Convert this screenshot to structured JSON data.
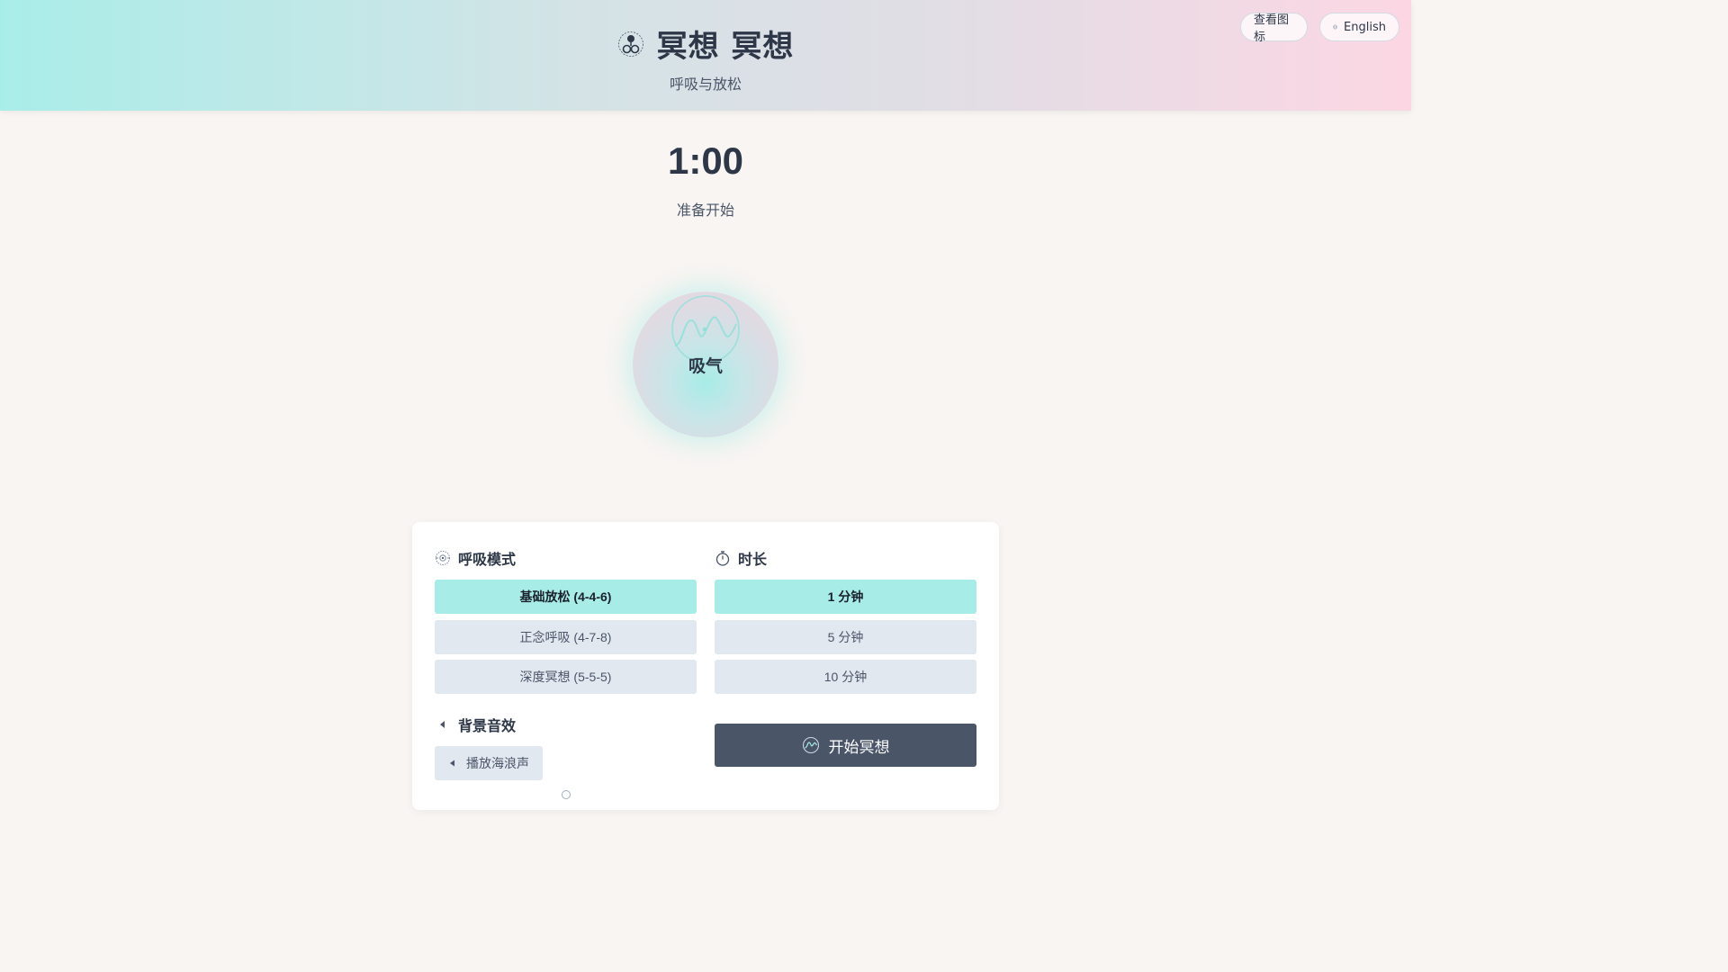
{
  "header": {
    "title": "冥想 冥想",
    "subtitle": "呼吸与放松",
    "icons_button_label": "查看图标",
    "language_button_label": "English"
  },
  "timer": {
    "display": "1:00",
    "status": "准备开始"
  },
  "breath": {
    "phase": "吸气"
  },
  "patterns": {
    "title": "呼吸模式",
    "options": [
      {
        "label": "基础放松 (4-4-6)",
        "active": true
      },
      {
        "label": "正念呼吸 (4-7-8)",
        "active": false
      },
      {
        "label": "深度冥想 (5-5-5)",
        "active": false
      }
    ]
  },
  "duration": {
    "title": "时长",
    "options": [
      {
        "label": "1 分钟",
        "active": true
      },
      {
        "label": "5 分钟",
        "active": false
      },
      {
        "label": "10 分钟",
        "active": false
      }
    ]
  },
  "sound": {
    "title": "背景音效",
    "button_label": "播放海浪声"
  },
  "start": {
    "label": "开始冥想"
  },
  "icons": {
    "logo": "meditation-logo-icon",
    "language": "globe-icon",
    "breath": "breath-wave-icon",
    "patterns": "breathing-target-icon",
    "duration": "stopwatch-icon",
    "sound": "speaker-icon",
    "start": "wave-circle-icon"
  },
  "colors": {
    "accent": "#a8ece7",
    "header_left": "#a9ede9",
    "header_right": "#fcd7e3",
    "primary_button": "#4a5568",
    "option_inactive": "#e2e8f0",
    "text_dark": "#2d3748"
  }
}
